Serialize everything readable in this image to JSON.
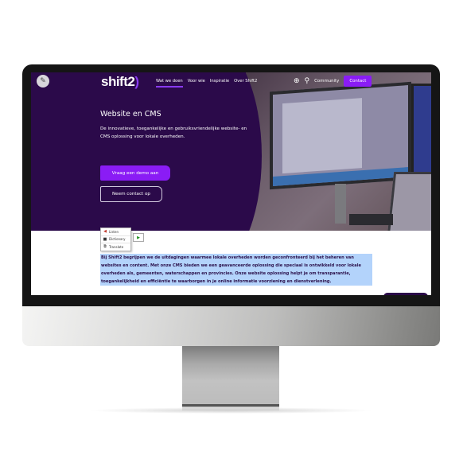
{
  "site": {
    "logo_text": "shift2",
    "logo_paren": ")",
    "nav": [
      {
        "label": "Wat we doen",
        "active": true
      },
      {
        "label": "Voor wie",
        "active": false
      },
      {
        "label": "Inspiratie",
        "active": false
      },
      {
        "label": "Over Shift2",
        "active": false
      }
    ],
    "utils": {
      "accessibility_icon": "accessibility-icon",
      "search_icon": "search-icon",
      "community_label": "Community",
      "contact_label": "Contact"
    },
    "edit_icon": "pencil-icon"
  },
  "hero": {
    "title": "Website en CMS",
    "description": "De innovatieve, toegankelijke en gebruiksvriendelijke website- en CMS oplossing voor lokale overheden.",
    "primary_button": "Vraag een demo aan",
    "secondary_button": "Neem contact op"
  },
  "tts_menu": {
    "items": [
      {
        "icon": "speaker-icon",
        "label": "Listen"
      },
      {
        "icon": "dictionary-icon",
        "label": "Dictionary"
      },
      {
        "icon": "translate-icon",
        "label": "Translate"
      }
    ],
    "play_icon": "play-icon"
  },
  "content": {
    "paragraph": "Bij Shift2 begrijpen we de uitdagingen waarmee lokale overheden worden geconfronteerd bij het beheren van websites en content. Met onze CMS bieden we een geavanceerde oplossing die speciaal is ontwikkeld voor lokale overheden als, gemeenten, waterschappen en provincies. Onze website oplossing helpt je om transparantie, toegankelijkheid en efficiëntie te waarborgen in je online informatie voorziening en dienstverlening."
  },
  "colors": {
    "hero_bg": "#2b0a4a",
    "accent": "#8a1cf5",
    "selection": "#b3d3fb"
  }
}
